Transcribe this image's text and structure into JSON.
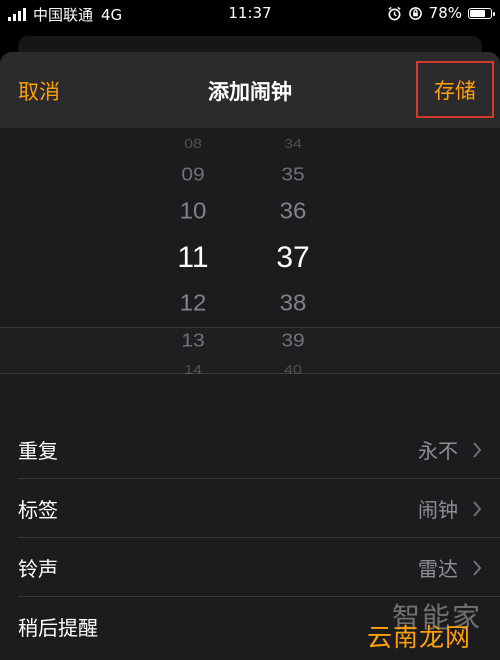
{
  "status_bar": {
    "carrier": "中国联通",
    "network": "4G",
    "time": "11:37",
    "battery": "78%",
    "battery_level": 0.78
  },
  "nav": {
    "cancel": "取消",
    "title": "添加闹钟",
    "save": "存储"
  },
  "picker": {
    "hours": [
      "08",
      "09",
      "10",
      "11",
      "12",
      "13",
      "14"
    ],
    "minutes": [
      "34",
      "35",
      "36",
      "37",
      "38",
      "39",
      "40"
    ],
    "selected_hour": "11",
    "selected_minute": "37"
  },
  "options": [
    {
      "label": "重复",
      "value": "永不"
    },
    {
      "label": "标签",
      "value": "闹钟"
    },
    {
      "label": "铃声",
      "value": "雷达"
    },
    {
      "label": "稍后提醒",
      "value": ""
    }
  ],
  "watermark": {
    "line1": "智能家",
    "line2": "云南龙网"
  },
  "colors": {
    "accent": "#ff9f0a",
    "highlight_box": "#d23a2a",
    "background": "#1c1c1e"
  }
}
